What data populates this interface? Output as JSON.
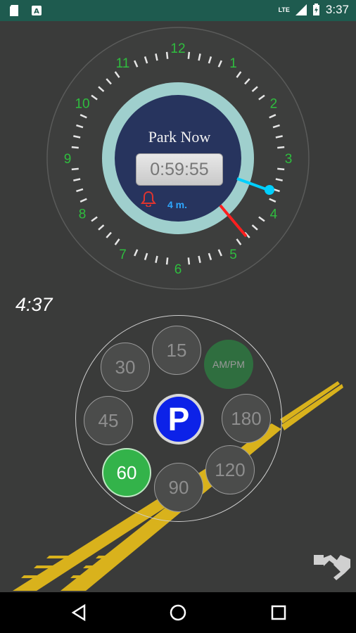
{
  "statusbar": {
    "network": "LTE",
    "battery": "battery-icon",
    "time": "3:37"
  },
  "clock": {
    "numbers": [
      "12",
      "1",
      "2",
      "3",
      "4",
      "5",
      "6",
      "7",
      "8",
      "9",
      "10",
      "11"
    ],
    "title": "Park Now",
    "timer": "0:59:55",
    "minutes_label": "4 m.",
    "colors": {
      "numbers": "#2fbd3e",
      "inner": "#27345e",
      "ring": "#9fcfcd",
      "minute_hand": "#00d0ff",
      "alarm_hand": "#ff1f1f",
      "bell": "#e0342f"
    }
  },
  "current_time": "4:37",
  "durations": {
    "buttons": [
      {
        "label": "15",
        "state": "normal"
      },
      {
        "label": "AM/PM",
        "state": "toggle"
      },
      {
        "label": "180",
        "state": "normal"
      },
      {
        "label": "120",
        "state": "normal"
      },
      {
        "label": "90",
        "state": "normal"
      },
      {
        "label": "60",
        "state": "selected"
      },
      {
        "label": "45",
        "state": "normal"
      },
      {
        "label": "30",
        "state": "normal"
      }
    ],
    "parking_button": "P"
  },
  "icons": {
    "handshake": "handshake-icon",
    "back": "back-icon",
    "home": "home-icon",
    "recents": "recents-icon"
  }
}
